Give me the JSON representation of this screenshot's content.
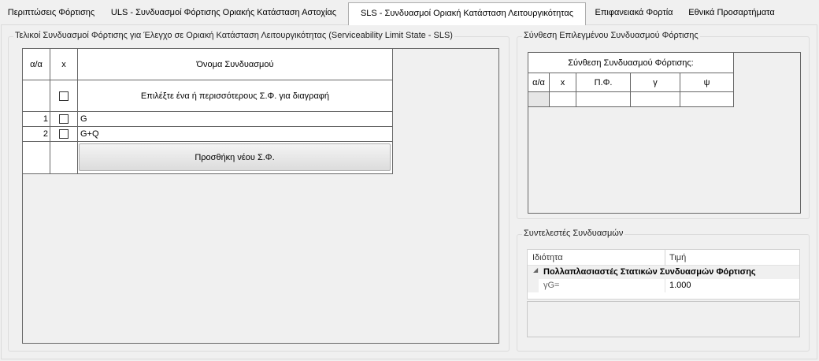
{
  "tabs": [
    {
      "label": "Περιπτώσεις Φόρτισης"
    },
    {
      "label": "ULS - Συνδυασμοί Φόρτισης Οριακής Κατάσταση Αστοχίας"
    },
    {
      "label": "SLS - Συνδυασμοί Οριακή Κατάσταση Λειτουργικότητας"
    },
    {
      "label": "Επιφανειακά Φορτία"
    },
    {
      "label": "Εθνικά Προσαρτήματα"
    }
  ],
  "left_group": {
    "title": "Τελικοί Συνδυασμοί Φόρτισης για Έλεγχο σε Οριακή Κατάσταση Λειτουργικότητας (Serviceability Limit State - SLS)",
    "columns": {
      "index": "α/α",
      "x": "x",
      "name": "Όνομα Συνδυασμού"
    },
    "select_hint": "Επιλέξτε ένα ή περισσότερους Σ.Φ. για διαγραφή",
    "rows": [
      {
        "index": "1",
        "name": "G"
      },
      {
        "index": "2",
        "name": "G+Q"
      }
    ],
    "add_button": "Προσθήκη νέου Σ.Φ."
  },
  "composition_group": {
    "title": "Σύνθεση Επιλεγμένου Συνδυασμού Φόρτισης",
    "table_title": "Σύνθεση Συνδυασμού Φόρτισης:",
    "columns": {
      "index": "α/α",
      "x": "x",
      "pf": "Π.Φ.",
      "gamma": "γ",
      "psi": "ψ"
    }
  },
  "coeff_group": {
    "title": "Συντελεστές Συνδυασμών",
    "columns": {
      "property": "Ιδιότητα",
      "value": "Τιμή"
    },
    "category": "Πολλαπλασιαστές Στατικών Συνδυασμών Φόρτισης",
    "items": [
      {
        "name": "γG=",
        "value": "1.000"
      }
    ]
  }
}
